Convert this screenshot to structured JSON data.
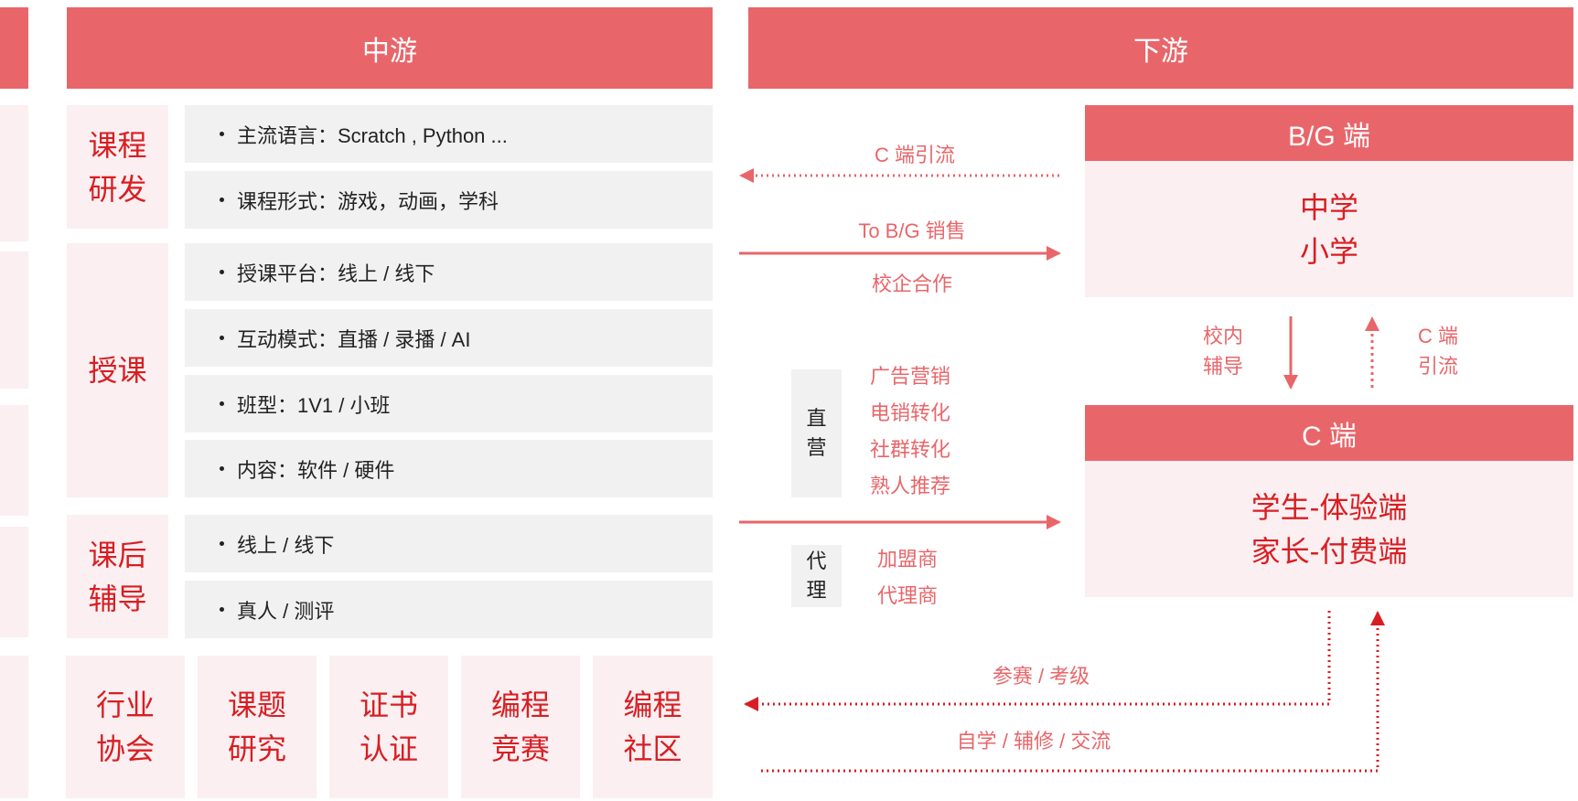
{
  "headers": {
    "midstream": "中游",
    "downstream": "下游"
  },
  "categories": {
    "course_dev": [
      "课程",
      "研发"
    ],
    "teaching": [
      "授课"
    ],
    "after_class": [
      "课后",
      "辅导"
    ]
  },
  "items": {
    "course_dev": [
      "主流语言：Scratch , Python ...",
      "课程形式：游戏，动画，学科"
    ],
    "teaching": [
      "授课平台：线上 / 线下",
      "互动模式：直播 / 录播 / AI",
      "班型：1V1 / 小班",
      "内容：软件 / 硬件"
    ],
    "after_class": [
      "线上 / 线下",
      "真人 / 测评"
    ]
  },
  "bottom_row": [
    [
      "行业",
      "协会"
    ],
    [
      "课题",
      "研究"
    ],
    [
      "证书",
      "认证"
    ],
    [
      "编程",
      "竞赛"
    ],
    [
      "编程",
      "社区"
    ]
  ],
  "arrows": {
    "c_traffic_left": "C 端引流",
    "to_bg_sales": "To B/G 销售",
    "school_coop": "校企合作",
    "in_school": [
      "校内",
      "辅导"
    ],
    "c_traffic_up": [
      "C 端",
      "引流"
    ],
    "competition": "参赛 / 考级",
    "self_study": "自学 / 辅修 / 交流"
  },
  "channels": {
    "direct": {
      "label": [
        "直",
        "营"
      ],
      "items": [
        "广告营销",
        "电销转化",
        "社群转化",
        "熟人推荐"
      ]
    },
    "agent": {
      "label": [
        "代",
        "理"
      ],
      "items": [
        "加盟商",
        "代理商"
      ]
    }
  },
  "bg_box": {
    "title": "B/G 端",
    "lines": [
      "中学",
      "小学"
    ]
  },
  "c_box": {
    "title": "C 端",
    "lines": [
      "学生-体验端",
      "家长-付费端"
    ]
  },
  "colors": {
    "accent": "#e8666a",
    "accent_dark": "#d81e22",
    "pink_bg": "#fbeff1",
    "gray_bg": "#f1f1f1"
  }
}
